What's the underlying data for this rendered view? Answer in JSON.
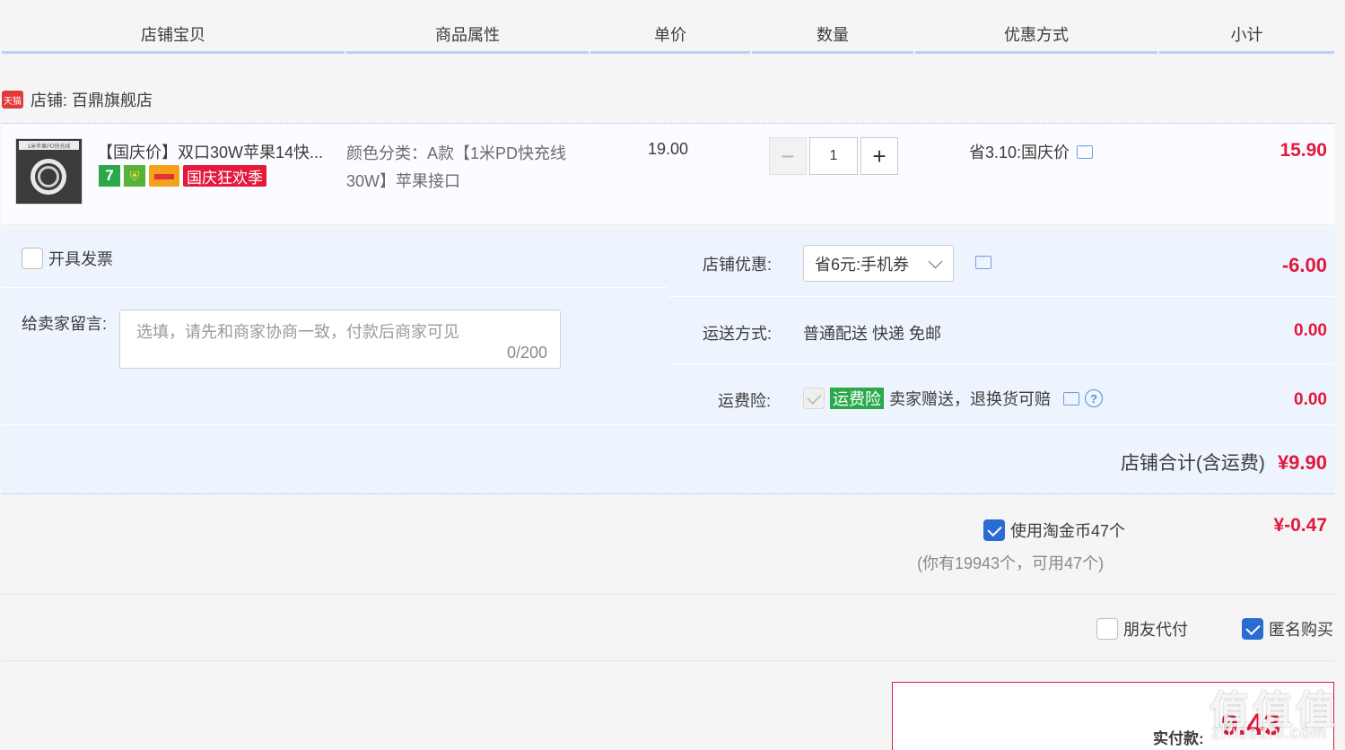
{
  "columns": [
    "店铺宝贝",
    "商品属性",
    "单价",
    "数量",
    "优惠方式",
    "小计"
  ],
  "shop": {
    "badge": "天猫",
    "name": "店铺: 百鼎旗舰店"
  },
  "item": {
    "thumb_caption": "1米苹果PD快充线",
    "title": "【国庆价】双口30W苹果14快...",
    "badge_7": "7",
    "badge_holiday": "国庆狂欢季",
    "attr": "颜色分类：A款【1米PD快充线30W】苹果接口",
    "price": "19.00",
    "qty_minus": "−",
    "qty": "1",
    "qty_plus": "+",
    "promo": "省3.10:国庆价",
    "subtotal": "15.90"
  },
  "options": {
    "invoice_label": "开具发票",
    "memo_label": "给卖家留言:",
    "memo_placeholder": "选填，请先和商家协商一致，付款后商家可见",
    "memo_count": "0/200",
    "shop_discount_label": "店铺优惠:",
    "shop_discount_value": "省6元:手机券",
    "shop_discount_amount": "-6.00",
    "shipping_label": "运送方式:",
    "shipping_value": "普通配送 快递 免邮",
    "shipping_amount": "0.00",
    "insurance_label": "运费险:",
    "insurance_tag": "运费险",
    "insurance_text": "卖家赠送，退换货可赔",
    "insurance_help": "?",
    "insurance_amount": "0.00"
  },
  "shop_total": {
    "label": "店铺合计(含运费)",
    "amount": "¥9.90"
  },
  "coins": {
    "label": "使用淘金币47个",
    "note": "(你有19943个，可用47个)",
    "amount": "¥-0.47"
  },
  "pay_options": {
    "friend_pay": "朋友代付",
    "anonymous": "匿名购买"
  },
  "total": {
    "label": "实付款:",
    "yen": "¥",
    "amount": "9.43"
  },
  "watermark": {
    "chars": [
      "值",
      "值",
      "值"
    ],
    "url": "zhidezhi.com"
  }
}
